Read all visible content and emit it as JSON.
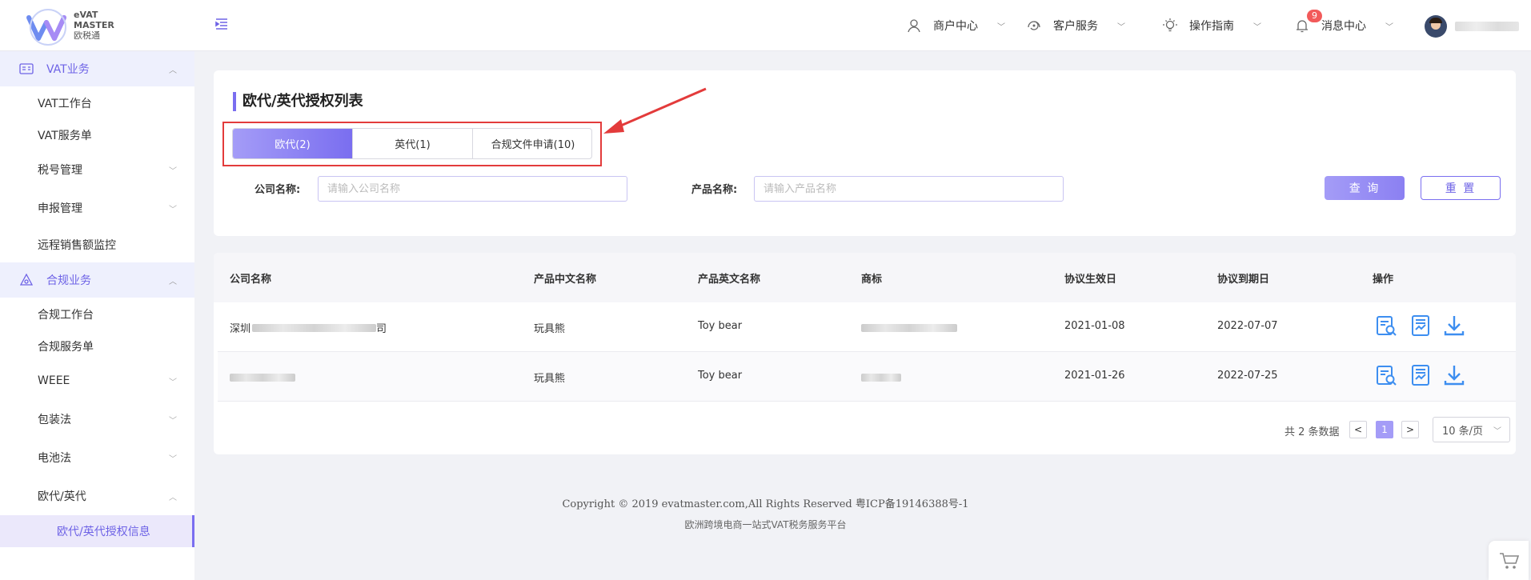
{
  "brand": {
    "line1": "eVAT",
    "line2": "MASTER",
    "line3": "欧税通"
  },
  "topnav": {
    "merchant": "商户中心",
    "service": "客户服务",
    "guide": "操作指南",
    "messages": "消息中心",
    "message_count": "9"
  },
  "sidebar": {
    "vat_group": "VAT业务",
    "vat_items": [
      "VAT工作台",
      "VAT服务单",
      "税号管理",
      "申报管理",
      "远程销售额监控"
    ],
    "compliance_group": "合规业务",
    "compliance_items": [
      "合规工作台",
      "合规服务单",
      "WEEE",
      "包装法",
      "电池法",
      "欧代/英代"
    ],
    "active_item": "欧代/英代授权信息"
  },
  "page": {
    "title": "欧代/英代授权列表",
    "tabs": [
      "欧代(2)",
      "英代(1)",
      "合规文件申请(10)"
    ],
    "filters": {
      "company_label": "公司名称:",
      "company_placeholder": "请输入公司名称",
      "product_label": "产品名称:",
      "product_placeholder": "请输入产品名称"
    },
    "buttons": {
      "query": "查 询",
      "reset": "重 置"
    }
  },
  "table": {
    "columns": [
      "公司名称",
      "产品中文名称",
      "产品英文名称",
      "商标",
      "协议生效日",
      "协议到期日",
      "操作"
    ],
    "rows": [
      {
        "company_prefix": "深圳",
        "company_suffix": "司",
        "product_cn": "玩具熊",
        "product_en": "Toy bear",
        "start": "2021-01-08",
        "end": "2022-07-07"
      },
      {
        "company_prefix": "",
        "company_suffix": "",
        "product_cn": "玩具熊",
        "product_en": "Toy bear",
        "start": "2021-01-26",
        "end": "2022-07-25"
      }
    ]
  },
  "pagination": {
    "total": "共 2 条数据",
    "current": "1",
    "page_size": "10 条/页"
  },
  "footer": {
    "copyright": "Copyright © 2019 evatmaster.com,All Rights Reserved 粤ICP备19146388号-1",
    "slogan": "欧洲跨境电商一站式VAT税务服务平台"
  },
  "colors": {
    "accent": "#7a6ef0",
    "accent_light": "#a49cf7",
    "highlight": "#e33b3b",
    "badge": "#f25a5a"
  },
  "icons": [
    "menu-collapse-icon",
    "user-icon",
    "headset-icon",
    "lightbulb-icon",
    "bell-icon",
    "view-icon",
    "document-icon",
    "download-icon",
    "cart-icon"
  ]
}
